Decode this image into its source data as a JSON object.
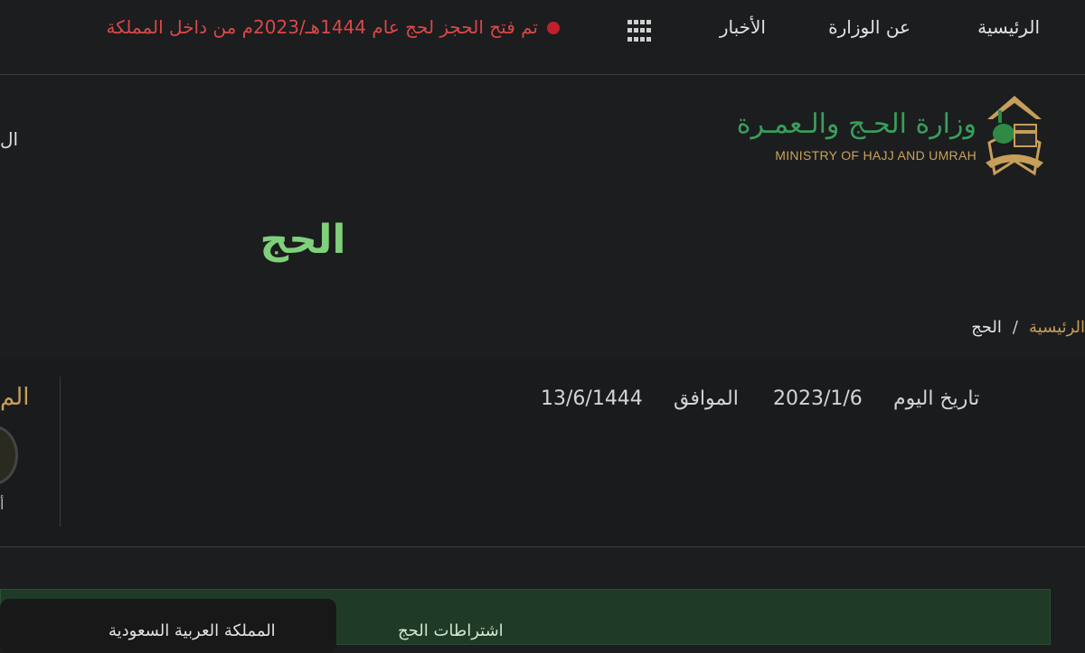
{
  "nav": {
    "home": "الرئيسية",
    "about": "عن الوزارة",
    "news": "الأخبار",
    "apps_icon": "grid-icon"
  },
  "ticker": {
    "text": "تم فتح الحجز لحج عام 1444هـ/2023م من داخل المملكة",
    "dot_color": "#c01f2b"
  },
  "logo": {
    "arabic": "وزارة الحـج والـعمـرة",
    "english": "MINISTRY OF HAJJ AND UMRAH"
  },
  "edge_text": "ال",
  "page": {
    "title": "الحج"
  },
  "breadcrumb": {
    "home": "الرئيسية",
    "separator": "/",
    "current": "الحج"
  },
  "dates": {
    "today_label": "تاريخ اليوم",
    "gregorian": "2023/1/6",
    "equivalent_label": "الموافق",
    "hijri": "13/6/1444"
  },
  "side": {
    "title": "الم",
    "caption": "أ"
  },
  "banner": {
    "text_a": "اشتراطات الحج",
    "text_b": "المملكة العربية السعودية"
  },
  "colors": {
    "accent_gold": "#c79e5a",
    "title_green": "#7fd07a",
    "logo_green": "#3a9e5a",
    "ticker_red": "#d94848"
  }
}
